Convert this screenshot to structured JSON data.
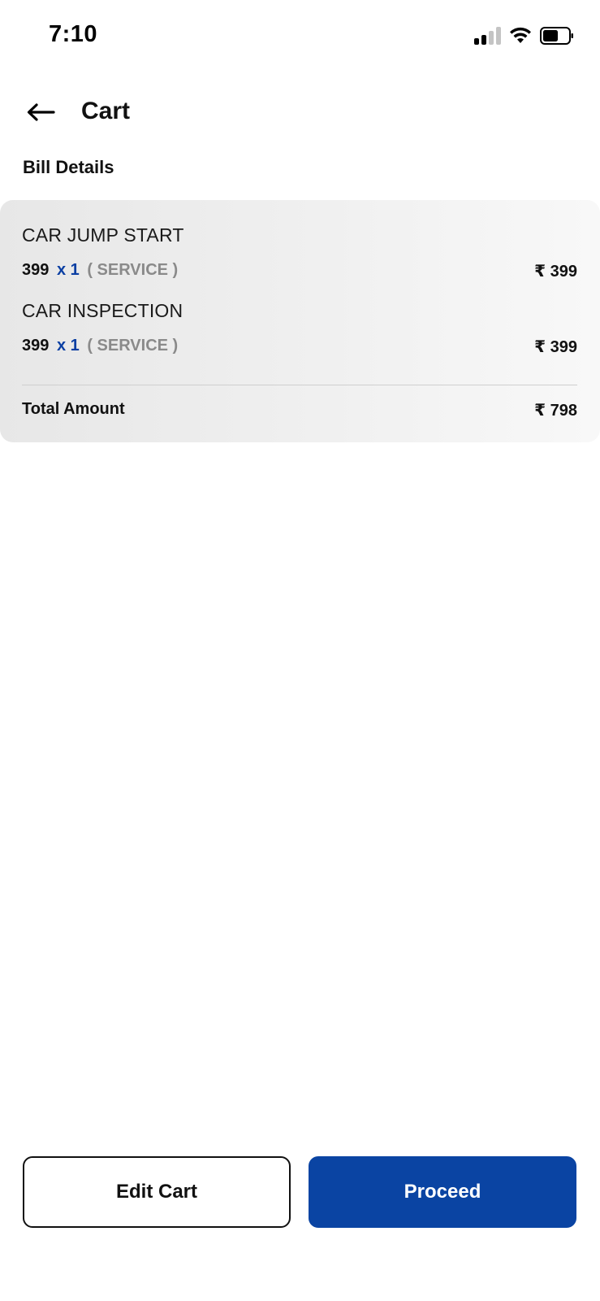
{
  "status_bar": {
    "time": "7:10",
    "signal_icon": "cellular-signal-icon",
    "wifi_icon": "wifi-icon",
    "battery_icon": "battery-icon"
  },
  "header": {
    "back_icon": "arrow-left-icon",
    "title": "Cart"
  },
  "bill": {
    "section_title": "Bill Details",
    "items": [
      {
        "name": "CAR JUMP START",
        "price": "399",
        "qty": "x 1",
        "type": "( SERVICE  )",
        "amount": "₹ 399"
      },
      {
        "name": "CAR INSPECTION",
        "price": "399",
        "qty": "x 1",
        "type": "( SERVICE  )",
        "amount": "₹ 399"
      }
    ],
    "total_label": "Total Amount",
    "total_value": "₹ 798"
  },
  "actions": {
    "edit_label": "Edit Cart",
    "proceed_label": "Proceed"
  },
  "colors": {
    "accent": "#0a44a3",
    "qty": "#0b3fa3",
    "muted": "#8a8a8a"
  }
}
